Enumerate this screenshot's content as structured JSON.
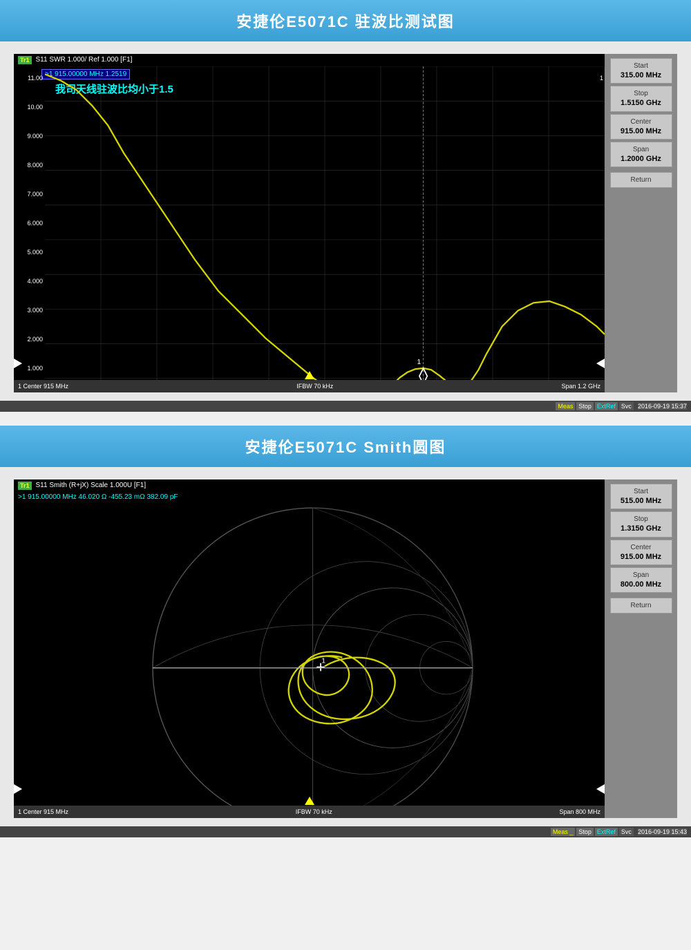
{
  "page": {
    "title1": "安捷伦E5071C  驻波比测试图",
    "title2": "安捷伦E5071C  Smith圆图"
  },
  "chart1": {
    "header": "S11 SWR 1.000/ Ref 1.000 [F1]",
    "marker": ">1   915.00000 MHz  1.2519",
    "annotation": "我司天线驻波比均小于1.5",
    "yLabels": [
      "11.00",
      "10.00",
      "9.000",
      "8.000",
      "7.000",
      "6.000",
      "5.000",
      "4.000",
      "3.000",
      "2.000",
      "1.000"
    ],
    "bottomLeft": "1 Center 915 MHz",
    "bottomCenter": "IFBW 70 kHz",
    "bottomRight": "Span 1.2 GHz",
    "statusTime": "2016-09-19 15:37",
    "sidePanel": {
      "btn1Label": "Start",
      "btn1Value": "315.00 MHz",
      "btn2Label": "Stop",
      "btn2Value": "1.5150 GHz",
      "btn3Label": "Center",
      "btn3Value": "915.00 MHz",
      "btn4Label": "Span",
      "btn4Value": "1.2000 GHz",
      "btn5Label": "Return"
    }
  },
  "chart2": {
    "header": "S11 Smith (R+jX) Scale 1.000U [F1]",
    "marker": ">1   915.00000 MHz  46.020 Ω  -455.23 mΩ  382.09 pF",
    "bottomLeft": "1 Center 915 MHz",
    "bottomCenter": "IFBW 70 kHz",
    "bottomRight": "Span 800 MHz",
    "statusTime": "2016-09-19 15:43",
    "sidePanel": {
      "btn1Label": "Start",
      "btn1Value": "515.00 MHz",
      "btn2Label": "Stop",
      "btn2Value": "1.3150 GHz",
      "btn3Label": "Center",
      "btn3Value": "915.00 MHz",
      "btn4Label": "Span",
      "btn4Value": "800.00 MHz",
      "btn5Label": "Return"
    }
  },
  "status": {
    "meas": "Meas",
    "stop": "Stop",
    "extref": "ExtRef",
    "svc": "Svc"
  }
}
